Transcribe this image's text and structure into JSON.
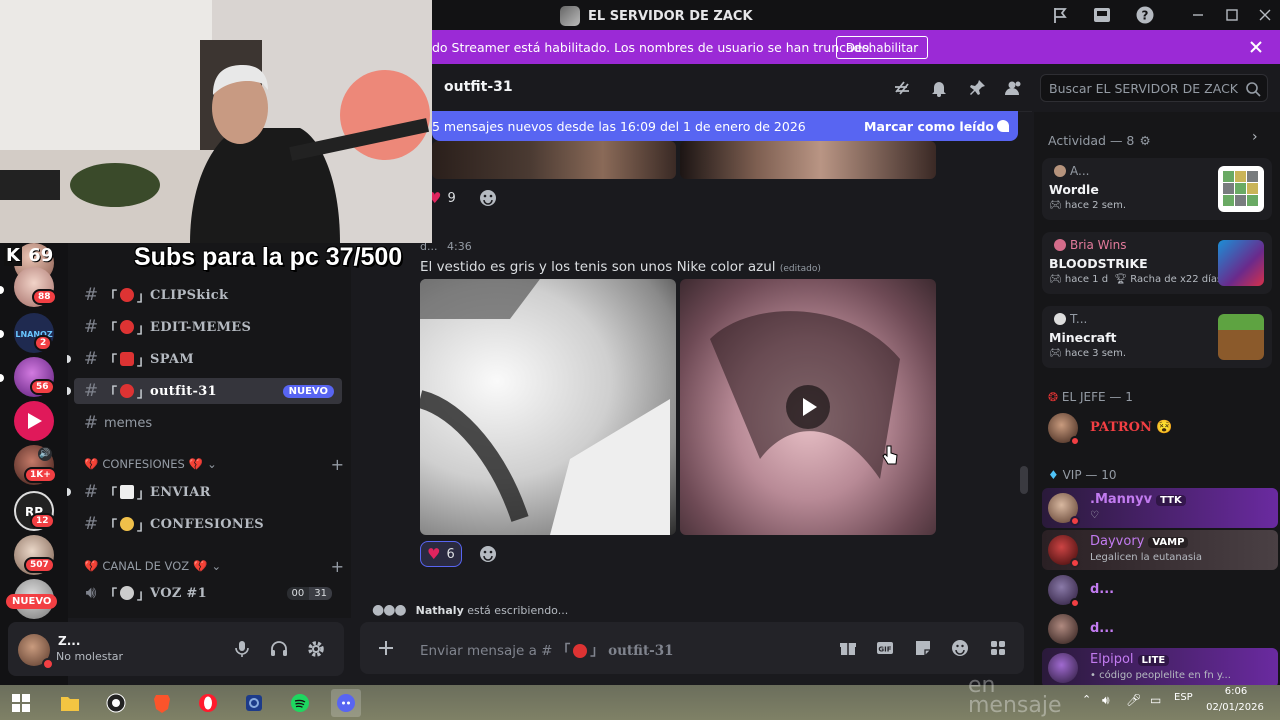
{
  "window": {
    "title": "EL SERVIDOR DE ZACK"
  },
  "banner": {
    "text": "do Streamer está habilitado. Los nombres de usuario se han truncado.",
    "button": "Deshabilitar"
  },
  "overlay": {
    "subs_text": "Subs para la pc 37/500",
    "kick_count": "69"
  },
  "rail": {
    "badges": [
      "88",
      "2",
      "56",
      "1K+",
      "12",
      "507"
    ],
    "nuevo": "NUEVO"
  },
  "channels": {
    "items": [
      {
        "name": "CLIPSkick",
        "deco": "😡"
      },
      {
        "name": "EDIT-MEMES",
        "deco": "😡"
      },
      {
        "name": "SPAM",
        "deco": "❓"
      },
      {
        "name": "outfit-31",
        "deco": "😡",
        "tag": "NUEVO"
      },
      {
        "name": "memes"
      },
      {
        "name": "ENVIAR",
        "deco": "📩"
      },
      {
        "name": "CONFESIONES",
        "deco": "🙁"
      }
    ],
    "cat_confesiones": "CONFESIONES",
    "cat_voz": "CANAL DE VOZ",
    "voice": {
      "name": "VOZ #1",
      "count_left": "00",
      "count_right": "31"
    }
  },
  "user": {
    "name": "Z...",
    "status": "No molestar"
  },
  "header": {
    "channel": "outfit-31",
    "search_placeholder": "Buscar EL SERVIDOR DE ZACK"
  },
  "newbar": {
    "text": "5 mensajes nuevos desde las 16:09 del 1 de enero de 2026",
    "mark": "Marcar como leído"
  },
  "messages": {
    "r1_count": "9",
    "author": "d...",
    "time": "4:36",
    "text": "El vestido es gris y los tenis son unos Nike color azul",
    "edited": "(editado)",
    "r2_count": "6"
  },
  "typing": {
    "who": "Nathaly",
    "rest": " está escribiendo..."
  },
  "composer": {
    "placeholder_prefix": "Enviar mensaje a #",
    "channel": "outfit-31"
  },
  "activity": {
    "title": "Actividad — 8",
    "cards": [
      {
        "user": "A...",
        "game": "Wordle",
        "sub": "hace 2 sem."
      },
      {
        "user": "Bria Wins",
        "game": "BLOODSTRIKE",
        "sub": "hace 1 d",
        "extra": "Racha de x22 días"
      },
      {
        "user": "T...",
        "game": "Minecraft",
        "sub": "hace 3 sem."
      }
    ]
  },
  "members": {
    "jefe_title": "EL JEFE — 1",
    "jefe": [
      {
        "name": "PATRON"
      }
    ],
    "vip_title": "VIP — 10",
    "vip": [
      {
        "name": ".Mannyv",
        "tag": "TTK",
        "sub": "♡"
      },
      {
        "name": "Dayvory",
        "tag": "VAMP",
        "sub": "Legalicen la eutanasia"
      },
      {
        "name": "d..."
      },
      {
        "name": "d..."
      },
      {
        "name": "Elpipol",
        "tag": "LITE",
        "sub": "• código peoplelite en fn y..."
      }
    ]
  },
  "taskbar": {
    "lang": "ESP",
    "time": "6:06",
    "date": "02/01/2026"
  },
  "ghost_text": "en mensaje"
}
